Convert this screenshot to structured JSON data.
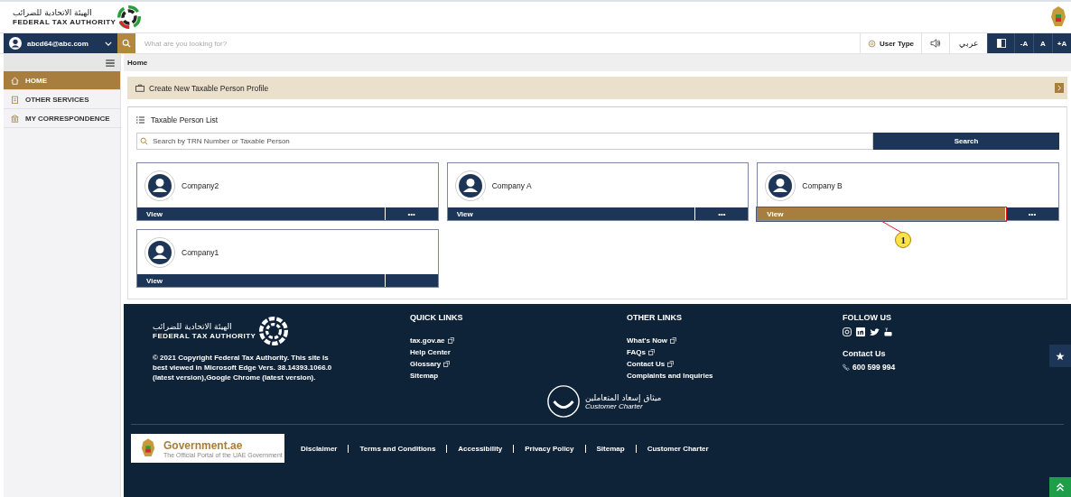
{
  "header": {
    "logo_arabic": "الهيئة الاتحادية للضرائب",
    "logo_english": "FEDERAL TAX AUTHORITY"
  },
  "topbar": {
    "user_email": "abcd64@abc.com",
    "search_placeholder": "What are you looking for?",
    "user_type": "User Type",
    "language": "عربي",
    "font_buttons": [
      "-A",
      "A",
      "+A"
    ]
  },
  "sidebar": {
    "items": [
      {
        "label": "HOME",
        "selected": true
      },
      {
        "label": "OTHER SERVICES",
        "selected": false
      },
      {
        "label": "MY CORRESPONDENCE",
        "selected": false
      }
    ]
  },
  "breadcrumb": "Home",
  "create_banner": "Create New Taxable Person Profile",
  "taxable_list": {
    "title": "Taxable Person List",
    "search_placeholder": "Search by TRN Number or Taxable Person",
    "search_button": "Search",
    "cards": [
      {
        "name": "Company2",
        "view": "View",
        "more": "•••",
        "selected": false
      },
      {
        "name": "Company A",
        "view": "View",
        "more": "•••",
        "selected": false
      },
      {
        "name": "Company B",
        "view": "View",
        "more": "•••",
        "selected": true,
        "annotation": "1"
      },
      {
        "name": "Company1",
        "view": "View",
        "selected": false
      }
    ]
  },
  "footer": {
    "logo_arabic": "الهيئة الاتحادية للضرائب",
    "logo_english": "FEDERAL TAX AUTHORITY",
    "copyright": "© 2021 Copyright Federal Tax Authority. This site is best viewed in Microsoft Edge Vers. 38.14393.1066.0 (latest version),Google Chrome (latest version).",
    "quick_links": {
      "title": "QUICK LINKS",
      "links": [
        {
          "label": "tax.gov.ae",
          "external": true
        },
        {
          "label": "Help Center",
          "external": false
        },
        {
          "label": "Glossary",
          "external": true
        },
        {
          "label": "Sitemap",
          "external": false
        }
      ]
    },
    "other_links": {
      "title": "OTHER LINKS",
      "links": [
        {
          "label": "What's Now",
          "external": true
        },
        {
          "label": "FAQs",
          "external": true
        },
        {
          "label": "Contact Us",
          "external": true
        },
        {
          "label": "Complaints and Inquiries",
          "external": false
        }
      ]
    },
    "follow_us": {
      "title": "FOLLOW US",
      "contact_title": "Contact Us",
      "phone": "600 599 994"
    },
    "charter": {
      "arabic": "ميثاق إسعاد المتعاملين",
      "english": "Customer Charter"
    },
    "government": {
      "name": "Government.ae",
      "tagline": "The Official Portal of the UAE Government"
    },
    "bottom_links": [
      "Disclaimer",
      "Terms and Conditions",
      "Accessibility",
      "Privacy Policy",
      "Sitemap",
      "Customer Charter"
    ]
  }
}
